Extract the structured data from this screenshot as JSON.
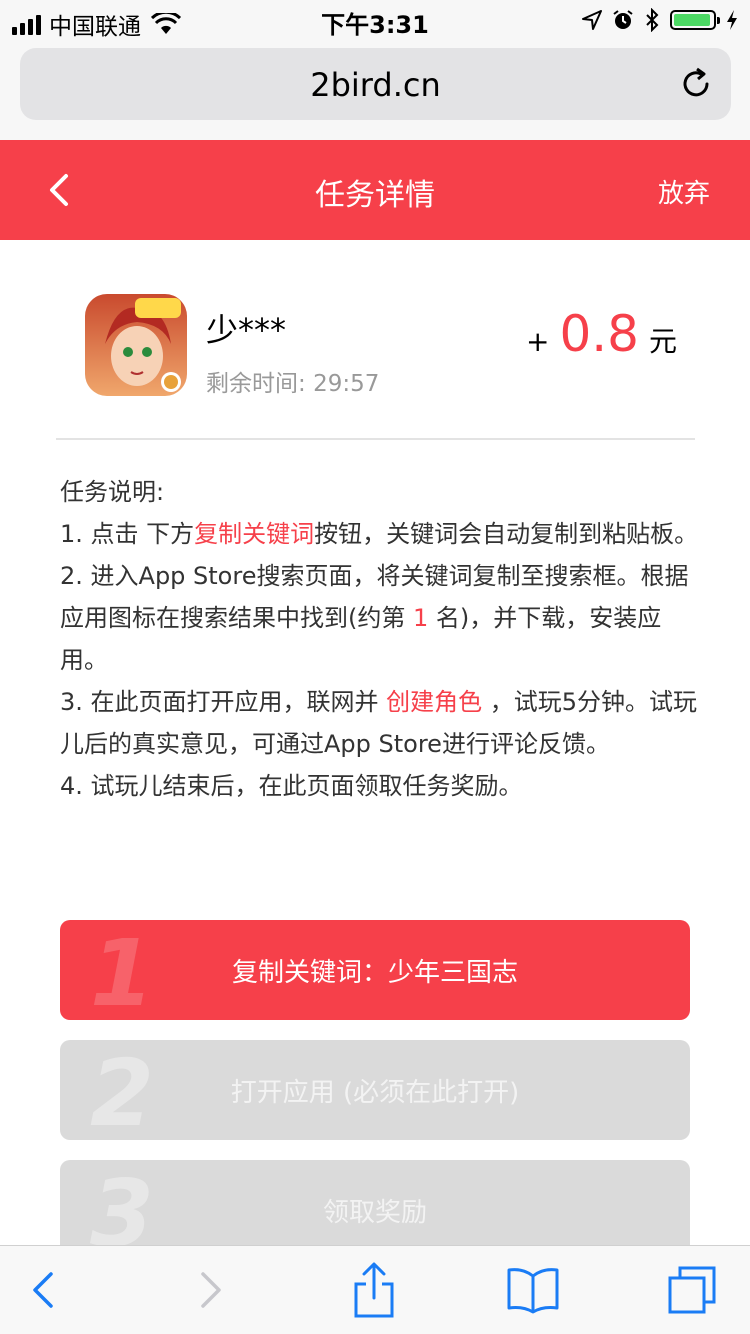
{
  "status_bar": {
    "carrier": "中国联通",
    "time": "下午3:31"
  },
  "browser": {
    "url": "2bird.cn"
  },
  "header": {
    "title": "任务详情",
    "give_up": "放弃"
  },
  "task": {
    "app_name": "少***",
    "remaining_label": "剩余时间:",
    "remaining_time": "29:57",
    "reward_plus": "+",
    "reward_amount": "0.8",
    "reward_unit": "元"
  },
  "instructions": {
    "title": "任务说明:",
    "step1_pre": "1. 点击 下方",
    "step1_hl": "复制关键词",
    "step1_post": "按钮，关键词会自动复制到粘贴板。",
    "step2_pre": "2. 进入App Store搜索页面，将关键词复制至搜索框。根据应用图标在搜索结果中找到(约第 ",
    "step2_hl": "1",
    "step2_post": " 名)，并下载，安装应用。",
    "step3_pre": "3. 在此页面打开应用，联网并 ",
    "step3_hl": "创建角色",
    "step3_post": " ，试玩5分钟。试玩儿后的真实意见，可通过App Store进行评论反馈。",
    "step4": "4. 试玩儿结束后，在此页面领取任务奖励。"
  },
  "steps": [
    {
      "number": "1",
      "label": "复制关键词：少年三国志"
    },
    {
      "number": "2",
      "label": "打开应用 (必须在此打开)"
    },
    {
      "number": "3",
      "label": "领取奖励"
    }
  ],
  "colors": {
    "accent": "#f6404a",
    "disabled": "#dadada",
    "battery": "#4cd964",
    "ios_blue": "#1a7cf5"
  },
  "icons": {
    "back": "chevron-left-icon",
    "reload": "reload-icon",
    "share": "share-icon",
    "bookmarks": "book-icon",
    "tabs": "tabs-icon"
  }
}
